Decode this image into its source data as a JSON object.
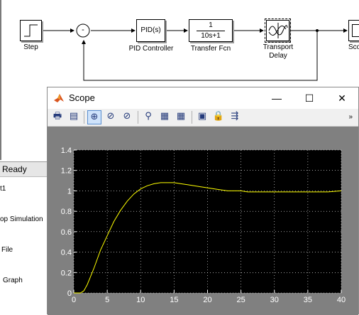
{
  "model": {
    "blocks": {
      "step": {
        "label": "Step"
      },
      "pid": {
        "text": "PID(s)",
        "label": "PID Controller"
      },
      "transfer": {
        "numerator": "1",
        "denominator": "10s+1",
        "label": "Transfer Fcn"
      },
      "delay": {
        "label_line1": "Transport",
        "label_line2": "Delay"
      },
      "scope": {
        "label": "Sco"
      }
    },
    "sum_sign": "-",
    "status": "Ready",
    "side_items": [
      "t1",
      "op Simulation",
      "File",
      "Graph"
    ]
  },
  "scope_window": {
    "title": "Scope",
    "controls": {
      "minimize": "—",
      "maximize": "☐",
      "close": "✕"
    },
    "toolbar": [
      {
        "name": "print-icon",
        "glyph": "🖶"
      },
      {
        "name": "parameters-icon",
        "glyph": "▤"
      },
      {
        "name": "zoom-in-icon",
        "glyph": "⊕",
        "active": true
      },
      {
        "name": "zoom-x-icon",
        "glyph": "⊘"
      },
      {
        "name": "zoom-y-icon",
        "glyph": "⊘"
      },
      {
        "name": "autoscale-icon",
        "glyph": "⚲"
      },
      {
        "name": "save-axes-icon",
        "glyph": "▦"
      },
      {
        "name": "restore-axes-icon",
        "glyph": "▦"
      },
      {
        "name": "floating-scope-icon",
        "glyph": "▣"
      },
      {
        "name": "lock-icon",
        "glyph": "🔒"
      },
      {
        "name": "signal-selection-icon",
        "glyph": "⇶"
      }
    ],
    "toolbar_more": "»",
    "colors": {
      "axes_bg": "#000000",
      "figure_bg": "#808080",
      "line": "#ffff00",
      "grid": "#ffffff",
      "tick_text": "#ffffff"
    }
  },
  "chart_data": {
    "type": "line",
    "xlim": [
      0,
      40
    ],
    "ylim": [
      0,
      1.4
    ],
    "xticks": [
      "0",
      "5",
      "10",
      "15",
      "20",
      "25",
      "30",
      "35",
      "40"
    ],
    "yticks": [
      "0",
      "0.2",
      "0.4",
      "0.6",
      "0.8",
      "1",
      "1.2",
      "1.4"
    ],
    "grid": true,
    "x": [
      0,
      1,
      1.5,
      2,
      3,
      4,
      5,
      6,
      7,
      8,
      9,
      10,
      11,
      12,
      13,
      14,
      15,
      16,
      17,
      18,
      19,
      20,
      21,
      22,
      23,
      24,
      25,
      26,
      28,
      30,
      32,
      34,
      36,
      38,
      40
    ],
    "y": [
      0,
      0,
      0.02,
      0.08,
      0.24,
      0.42,
      0.56,
      0.7,
      0.81,
      0.9,
      0.97,
      1.02,
      1.05,
      1.07,
      1.08,
      1.08,
      1.08,
      1.07,
      1.06,
      1.05,
      1.04,
      1.03,
      1.02,
      1.01,
      1.0,
      1.0,
      1.0,
      0.99,
      0.99,
      0.99,
      0.99,
      0.99,
      0.99,
      0.99,
      1.0
    ]
  }
}
